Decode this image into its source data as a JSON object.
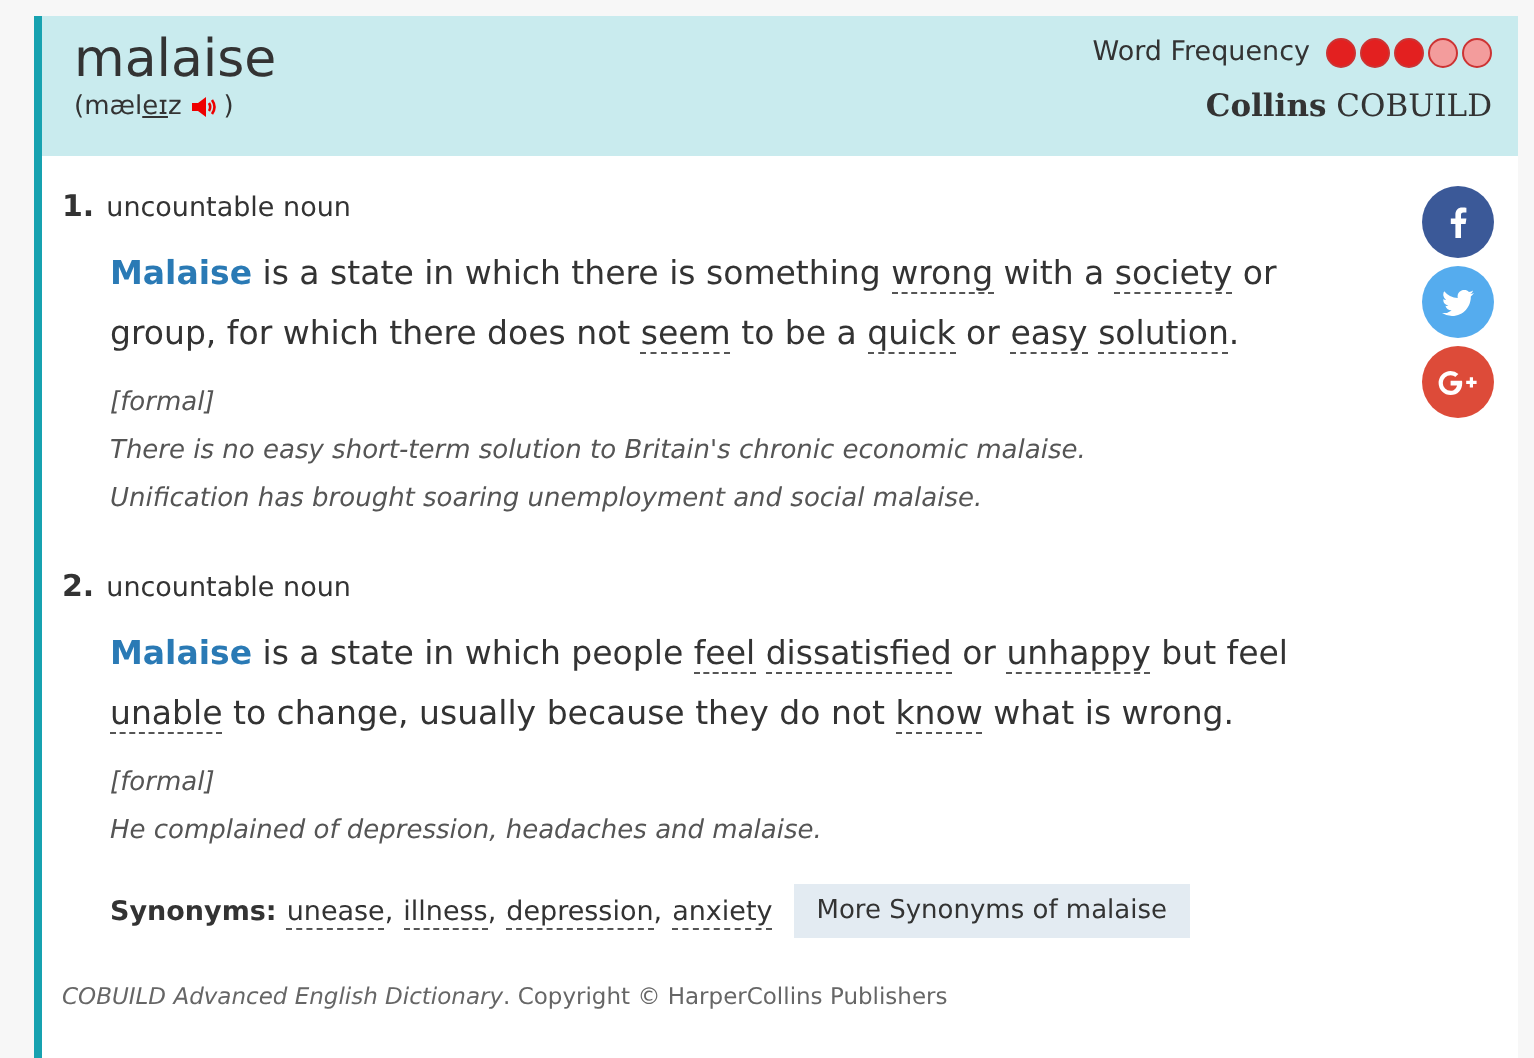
{
  "entry": {
    "headword": "malaise",
    "pronunciation": {
      "open": "(",
      "before": "mæl",
      "stressed": "eɪ",
      "after": "z",
      "close": ")"
    },
    "frequency": {
      "label": "Word Frequency",
      "stars": 3
    },
    "brand": {
      "bold": "Collins",
      "rest": "COBUILD"
    }
  },
  "share": [
    {
      "kind": "facebook"
    },
    {
      "kind": "twitter"
    },
    {
      "kind": "googleplus"
    }
  ],
  "senses": [
    {
      "number": "1.",
      "grammar": "uncountable noun",
      "definition": [
        {
          "kind": "headword",
          "text": "Malaise"
        },
        {
          "kind": "plain",
          "text": " is a state in which there is something "
        },
        {
          "kind": "link",
          "text": "wrong"
        },
        {
          "kind": "plain",
          "text": " with a "
        },
        {
          "kind": "link",
          "text": "society"
        },
        {
          "kind": "plain",
          "text": " or group, for which there does not "
        },
        {
          "kind": "link",
          "text": "seem"
        },
        {
          "kind": "plain",
          "text": " to be a "
        },
        {
          "kind": "link",
          "text": "quick"
        },
        {
          "kind": "plain",
          "text": " or "
        },
        {
          "kind": "link",
          "text": "easy"
        },
        {
          "kind": "link",
          "text": "solution"
        },
        {
          "kind": "plain",
          "text": "."
        }
      ],
      "register": "[formal]",
      "examples": [
        "There is no easy short-term solution to Britain's chronic economic malaise.",
        "Unification has brought soaring unemployment and social malaise."
      ]
    },
    {
      "number": "2.",
      "grammar": "uncountable noun",
      "definition": [
        {
          "kind": "headword",
          "text": "Malaise"
        },
        {
          "kind": "plain",
          "text": " is a state in which people "
        },
        {
          "kind": "link",
          "text": "feel"
        },
        {
          "kind": "link",
          "text": "dissatisfied"
        },
        {
          "kind": "plain",
          "text": " or "
        },
        {
          "kind": "link",
          "text": "unhappy"
        },
        {
          "kind": "plain",
          "text": " but feel "
        },
        {
          "kind": "link",
          "text": "unable"
        },
        {
          "kind": "plain",
          "text": " to change, usually because they do not "
        },
        {
          "kind": "link",
          "text": "know"
        },
        {
          "kind": "plain",
          "text": " what is wrong."
        }
      ],
      "register": "[formal]",
      "examples": [
        "He complained of depression, headaches and malaise."
      ],
      "synonyms": {
        "label": "Synonyms:",
        "items": [
          "unease",
          "illness",
          "depression",
          "anxiety"
        ],
        "separator": ",",
        "more": "More Synonyms of malaise"
      }
    }
  ],
  "footer": {
    "source": "COBUILD Advanced English Dictionary",
    "rest": ". Copyright © HarperCollins Publishers"
  }
}
